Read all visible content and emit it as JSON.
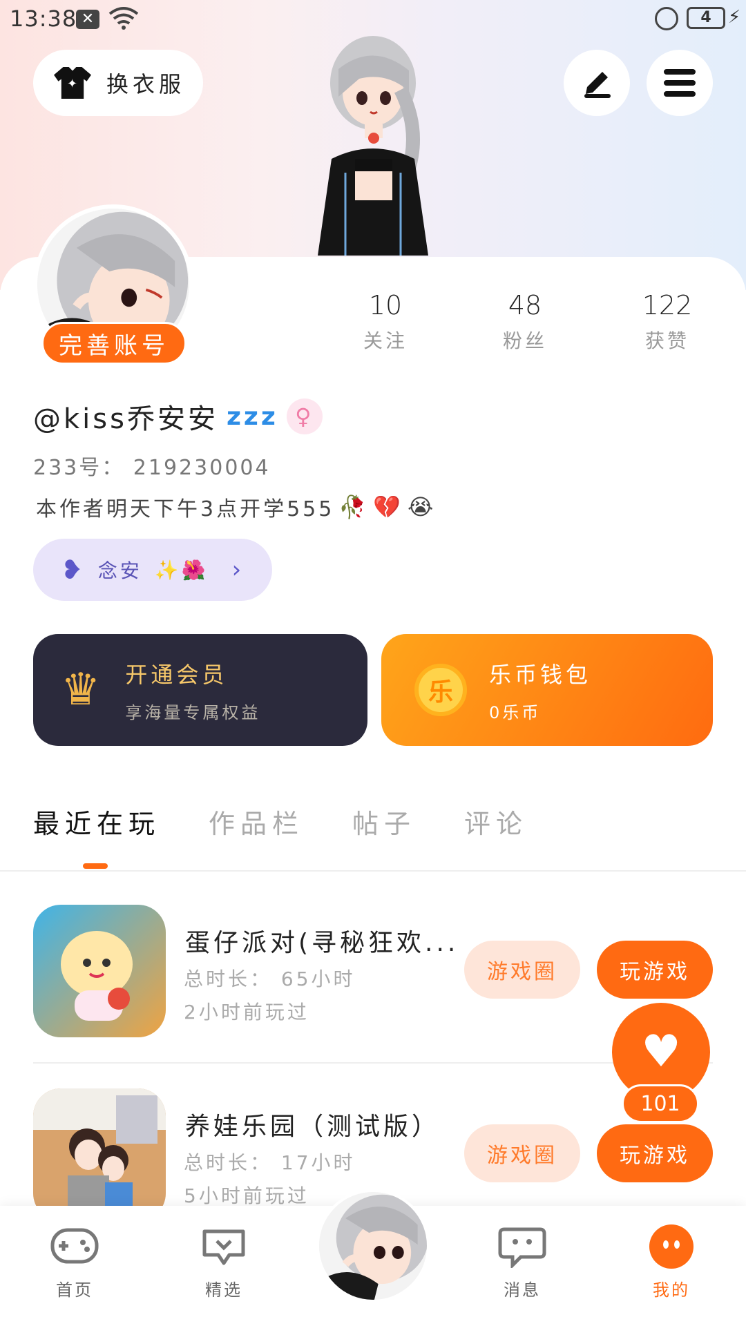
{
  "status_bar": {
    "time": "13:38",
    "battery": "4",
    "notification_icon": "x-icon"
  },
  "header": {
    "change_outfit_label": "换衣服",
    "edit_icon": "edit-icon",
    "menu_icon": "menu-icon"
  },
  "profile": {
    "complete_account_label": "完善账号",
    "username": "@kiss乔安安",
    "status_emoji": "zzz",
    "gender_symbol": "♀",
    "id_line": "233号： 219230004",
    "bio": "本作者明天下午3点开学555",
    "bio_emojis": [
      "🥀",
      "💔",
      "😭"
    ],
    "group_label": "念安",
    "group_emojis": "✨🌺",
    "stats": [
      {
        "value": "10",
        "label": "关注"
      },
      {
        "value": "48",
        "label": "粉丝"
      },
      {
        "value": "122",
        "label": "获赞"
      }
    ]
  },
  "cards": {
    "member": {
      "title": "开通会员",
      "subtitle": "享海量专属权益"
    },
    "wallet": {
      "coin_glyph": "乐",
      "title": "乐币钱包",
      "subtitle": "0乐币"
    }
  },
  "tabs": [
    {
      "label": "最近在玩",
      "active": true
    },
    {
      "label": "作品栏",
      "active": false
    },
    {
      "label": "帖子",
      "active": false
    },
    {
      "label": "评论",
      "active": false
    }
  ],
  "games": [
    {
      "name": "蛋仔派对(寻秘狂欢...",
      "duration": "总时长： 65小时",
      "last_played": "2小时前玩过",
      "circle_label": "游戏圈",
      "play_label": "玩游戏"
    },
    {
      "name": "养娃乐园（测试版）",
      "duration": "总时长： 17小时",
      "last_played": "5小时前玩过",
      "circle_label": "游戏圈",
      "play_label": "玩游戏"
    }
  ],
  "like_fab": {
    "count": "101"
  },
  "bottom_nav": [
    {
      "label": "首页",
      "icon": "gamepad-icon"
    },
    {
      "label": "精选",
      "icon": "heart-chat-icon"
    },
    {
      "label": "消息",
      "icon": "message-icon"
    },
    {
      "label": "我的",
      "icon": "face-icon",
      "active": true
    }
  ],
  "colors": {
    "accent": "#ff6a12",
    "member_bg": "#2b2a3c",
    "group_pill": "#e9e4fa"
  }
}
